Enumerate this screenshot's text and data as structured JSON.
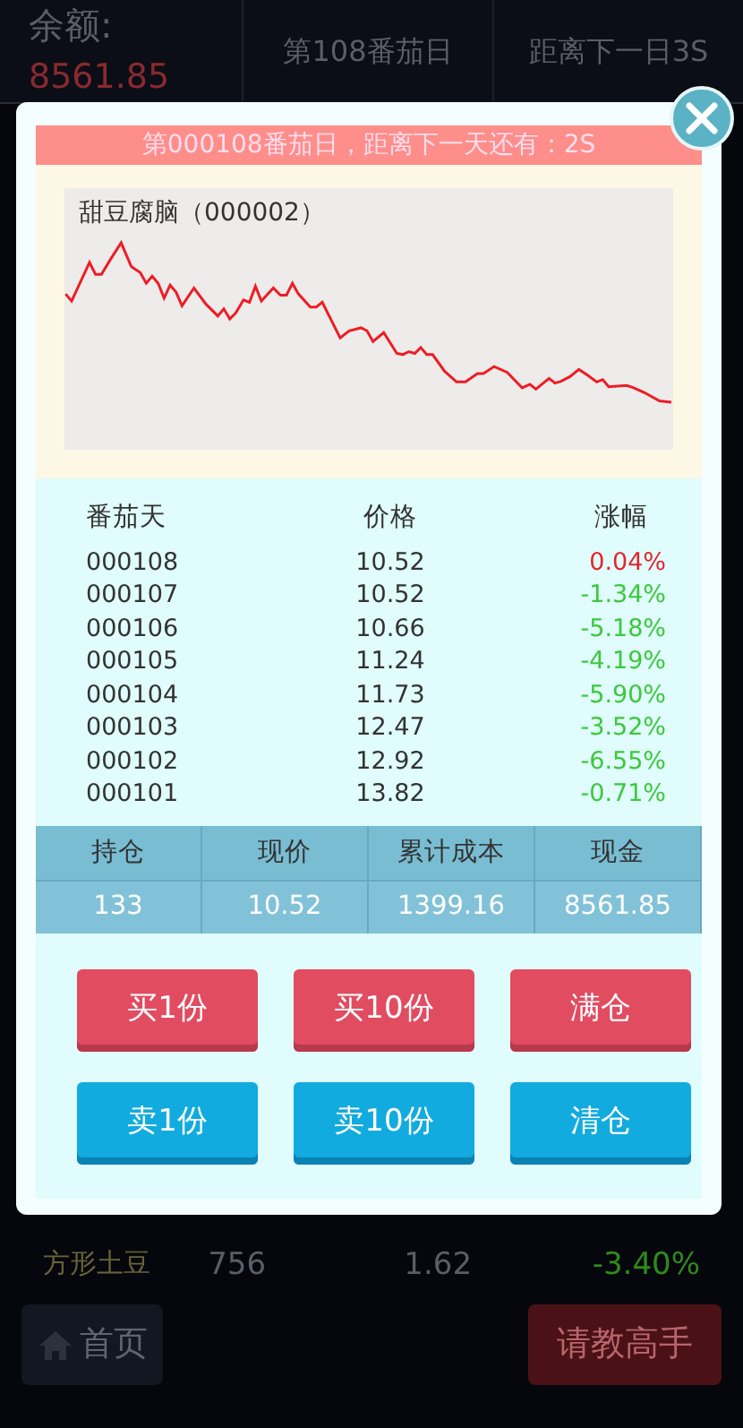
{
  "background": {
    "balance_label": "余额:",
    "balance_value": "8561.85",
    "day_label": "第108番茄日",
    "countdown": "距离下一日3S",
    "partial_row": {
      "name": "方形土豆",
      "quantity": "756",
      "price": "1.62",
      "change": "-3.40%",
      "color": "#2f8a1c"
    },
    "home_button": "首页",
    "ask_button": "请教高手"
  },
  "dialog": {
    "banner": "第000108番茄日，距离下一天还有：2S",
    "chart_title": "甜豆腐脑（000002）",
    "history": {
      "columns": [
        "番茄天",
        "价格",
        "涨幅"
      ],
      "rows": [
        {
          "day": "000108",
          "price": "10.52",
          "change": "0.04%",
          "color": "#e3262d"
        },
        {
          "day": "000107",
          "price": "10.52",
          "change": "-1.34%",
          "color": "#3cc83c"
        },
        {
          "day": "000106",
          "price": "10.66",
          "change": "-5.18%",
          "color": "#3cc83c"
        },
        {
          "day": "000105",
          "price": "11.24",
          "change": "-4.19%",
          "color": "#3cc83c"
        },
        {
          "day": "000104",
          "price": "11.73",
          "change": "-5.90%",
          "color": "#3cc83c"
        },
        {
          "day": "000103",
          "price": "12.47",
          "change": "-3.52%",
          "color": "#3cc83c"
        },
        {
          "day": "000102",
          "price": "12.92",
          "change": "-6.55%",
          "color": "#3cc83c"
        },
        {
          "day": "000101",
          "price": "13.82",
          "change": "-0.71%",
          "color": "#3cc83c"
        }
      ]
    },
    "holdings": {
      "columns": [
        "持仓",
        "现价",
        "累计成本",
        "现金"
      ],
      "values": [
        "133",
        "10.52",
        "1399.16",
        "8561.85"
      ]
    },
    "buttons": [
      {
        "label": "买1份",
        "kind": "buy"
      },
      {
        "label": "买10份",
        "kind": "buy"
      },
      {
        "label": "满仓",
        "kind": "buy"
      },
      {
        "label": "卖1份",
        "kind": "sell"
      },
      {
        "label": "卖10份",
        "kind": "sell"
      },
      {
        "label": "清仓",
        "kind": "sell"
      }
    ]
  }
}
